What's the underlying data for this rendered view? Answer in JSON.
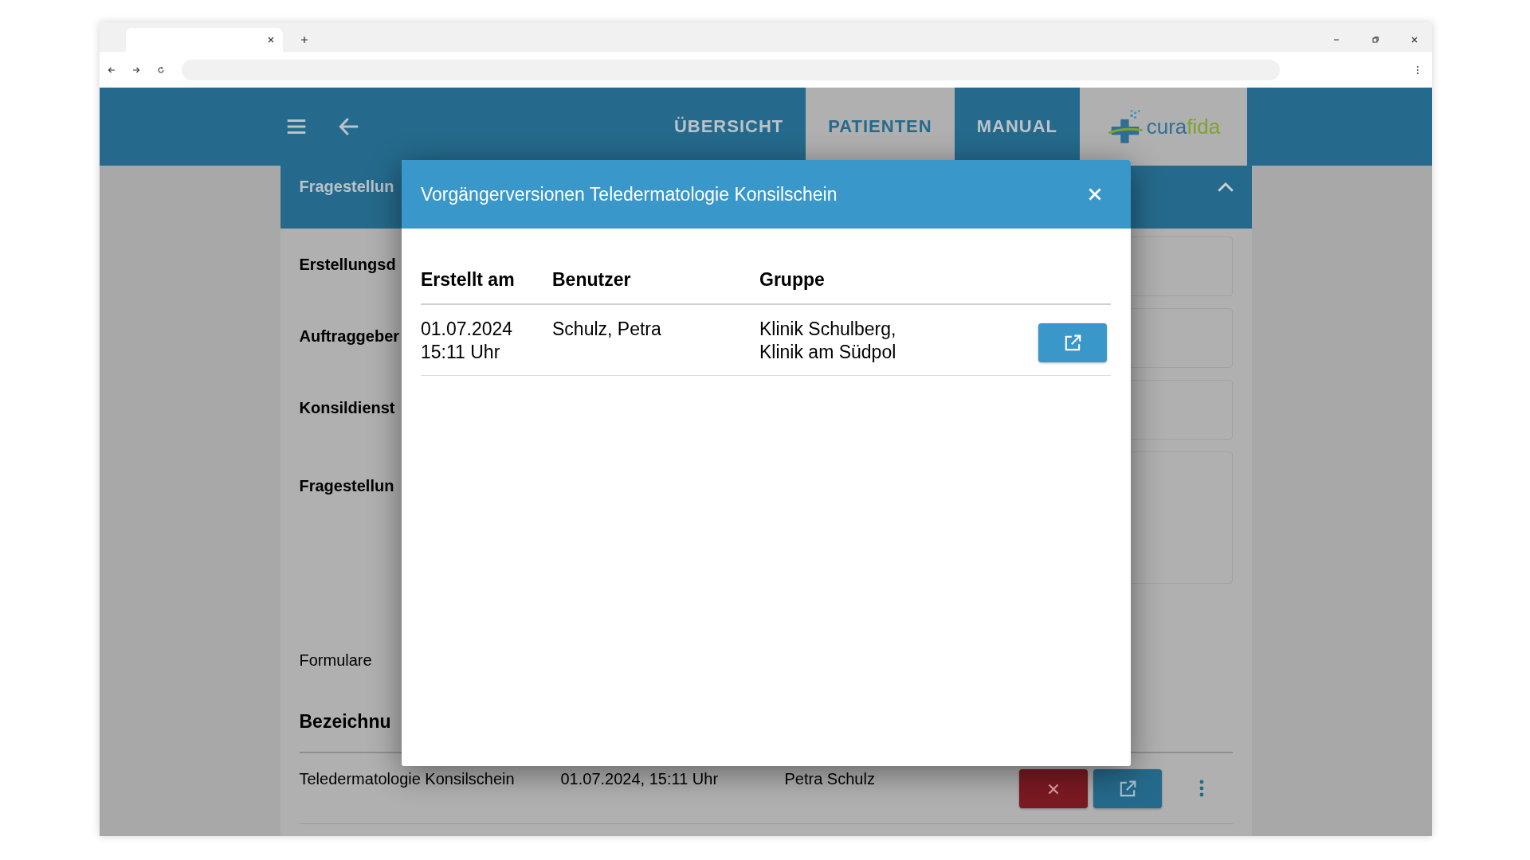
{
  "header": {
    "nav": [
      {
        "label": "ÜBERSICHT",
        "selected": false
      },
      {
        "label": "PATIENTEN",
        "selected": true
      },
      {
        "label": "MANUAL",
        "selected": false
      }
    ],
    "logo_parts": [
      "cura",
      "fida"
    ]
  },
  "card": {
    "title": "Fragestellun",
    "expanded": true,
    "fields": [
      {
        "label": "Erstellungsd",
        "kind": "line"
      },
      {
        "label": "Auftraggeber",
        "kind": "line"
      },
      {
        "label": "Konsildienst",
        "kind": "line"
      },
      {
        "label": "Fragestellun",
        "kind": "area"
      }
    ],
    "section_label": "Formulare",
    "forms": {
      "column_1": "Bezeichnu",
      "rows": [
        {
          "cells": [
            "Teledermatologie Konsilschein",
            "01.07.2024, 15:11 Uhr",
            "Petra Schulz"
          ]
        }
      ]
    }
  },
  "modal": {
    "title": "Vorgängerversionen Teledermatologie Konsilschein",
    "columns": [
      "Erstellt am",
      "Benutzer",
      "Gruppe"
    ],
    "rows": [
      {
        "created": "01.07.2024\n15:11 Uhr",
        "user": "Schulz, Petra",
        "group": "Klinik Schulberg,\nKlinik am Südpol"
      }
    ]
  }
}
